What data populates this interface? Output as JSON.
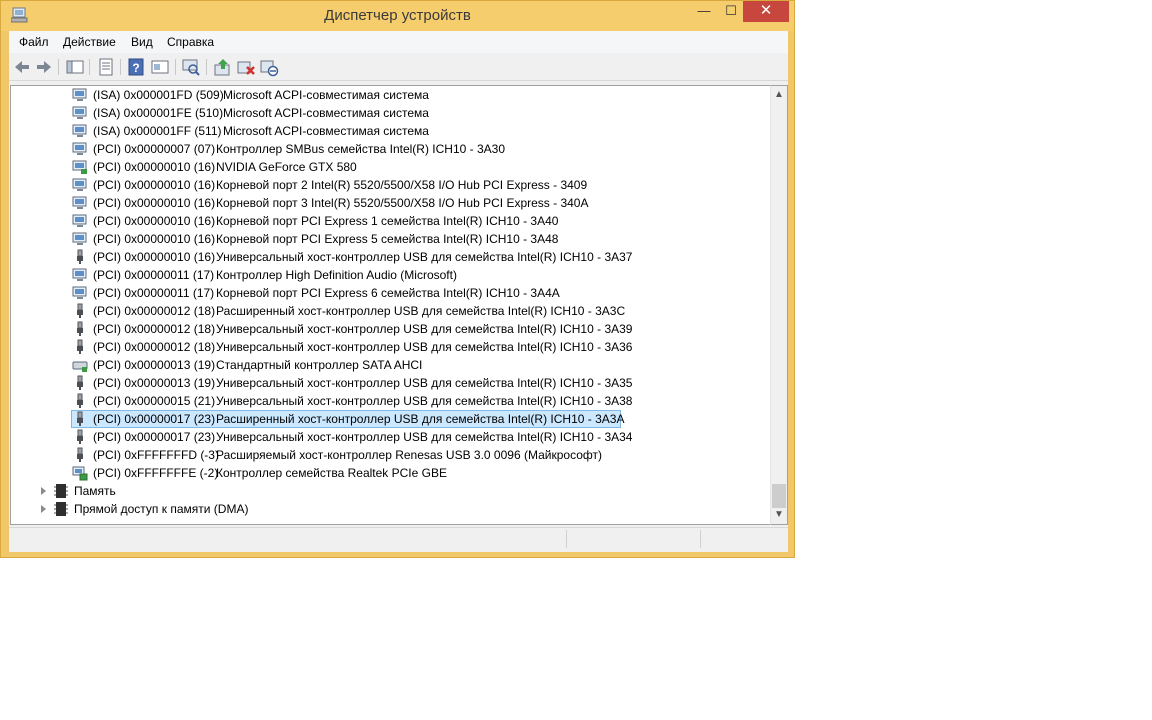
{
  "window": {
    "title": "Диспетчер устройств",
    "controls": {
      "minimize": "—",
      "maximize": "☐",
      "close": "✕"
    },
    "title_color": "#f5cd6c",
    "close_color": "#c7463d"
  },
  "menu": [
    {
      "label": "Файл"
    },
    {
      "label": "Действие"
    },
    {
      "label": "Вид"
    },
    {
      "label": "Справка"
    }
  ],
  "toolbar": {
    "icons": [
      "back-arrow-icon",
      "forward-arrow-icon",
      "show-hide-console-tree-icon",
      "properties-icon",
      "help-icon",
      "view-icon",
      "scan-hardware-icon",
      "update-driver-icon",
      "uninstall-device-icon",
      "disable-device-icon"
    ]
  },
  "devices": [
    {
      "icon": "monitor",
      "addr": "(ISA) 0x000001FD (509)",
      "name": "Microsoft ACPI-совместимая система"
    },
    {
      "icon": "monitor",
      "addr": "(ISA) 0x000001FE (510)",
      "name": "Microsoft ACPI-совместимая система"
    },
    {
      "icon": "monitor",
      "addr": "(ISA) 0x000001FF (511)",
      "name": "Microsoft ACPI-совместимая система"
    },
    {
      "icon": "monitor",
      "addr": "(PCI) 0x00000007 (07)",
      "name": "Контроллер SMBus семейства Intel(R) ICH10 - 3A30"
    },
    {
      "icon": "display",
      "addr": "(PCI) 0x00000010 (16)",
      "name": "NVIDIA GeForce GTX 580"
    },
    {
      "icon": "monitor",
      "addr": "(PCI) 0x00000010 (16)",
      "name": "Корневой порт 2 Intel(R) 5520/5500/X58 I/O Hub PCI Express - 3409"
    },
    {
      "icon": "monitor",
      "addr": "(PCI) 0x00000010 (16)",
      "name": "Корневой порт 3 Intel(R) 5520/5500/X58 I/O Hub PCI Express - 340A"
    },
    {
      "icon": "monitor",
      "addr": "(PCI) 0x00000010 (16)",
      "name": "Корневой порт PCI Express 1 семейства Intel(R) ICH10 - 3A40"
    },
    {
      "icon": "monitor",
      "addr": "(PCI) 0x00000010 (16)",
      "name": "Корневой порт PCI Express 5 семейства Intel(R) ICH10 - 3A48"
    },
    {
      "icon": "usb",
      "addr": "(PCI) 0x00000010 (16)",
      "name": "Универсальный хост-контроллер USB для семейства Intel(R) ICH10 - 3A37"
    },
    {
      "icon": "monitor",
      "addr": "(PCI) 0x00000011 (17)",
      "name": "Контроллер High Definition Audio (Microsoft)"
    },
    {
      "icon": "monitor",
      "addr": "(PCI) 0x00000011 (17)",
      "name": "Корневой порт PCI Express 6 семейства Intel(R) ICH10 - 3A4A"
    },
    {
      "icon": "usb",
      "addr": "(PCI) 0x00000012 (18)",
      "name": "Расширенный хост-контроллер USB для семейства Intel(R) ICH10 - 3A3C"
    },
    {
      "icon": "usb",
      "addr": "(PCI) 0x00000012 (18)",
      "name": "Универсальный хост-контроллер USB для семейства Intel(R) ICH10 - 3A39"
    },
    {
      "icon": "usb",
      "addr": "(PCI) 0x00000012 (18)",
      "name": "Универсальный хост-контроллер USB для семейства Intel(R) ICH10 - 3A36"
    },
    {
      "icon": "storage",
      "addr": "(PCI) 0x00000013 (19)",
      "name": "Стандартный контроллер SATA AHCI"
    },
    {
      "icon": "usb",
      "addr": "(PCI) 0x00000013 (19)",
      "name": "Универсальный хост-контроллер USB для семейства Intel(R) ICH10 - 3A35"
    },
    {
      "icon": "usb",
      "addr": "(PCI) 0x00000015 (21)",
      "name": "Универсальный хост-контроллер USB для семейства Intel(R) ICH10 - 3A38"
    },
    {
      "icon": "usb",
      "addr": "(PCI) 0x00000017 (23)",
      "name": "Расширенный хост-контроллер USB для семейства Intel(R) ICH10 - 3A3A",
      "selected": true
    },
    {
      "icon": "usb",
      "addr": "(PCI) 0x00000017 (23)",
      "name": "Универсальный хост-контроллер USB для семейства Intel(R) ICH10 - 3A34"
    },
    {
      "icon": "usb",
      "addr": "(PCI) 0xFFFFFFFD (-3)",
      "name": "Расширяемый хост-контроллер Renesas USB 3.0 0096 (Майкрософт)"
    },
    {
      "icon": "network",
      "addr": "(PCI) 0xFFFFFFFE (-2)",
      "name": "Контроллер семейства Realtek PCIe GBE"
    }
  ],
  "categories": [
    {
      "label": "Память"
    },
    {
      "label": "Прямой доступ к памяти (DMA)"
    }
  ],
  "selection_color": "#cce8ff"
}
